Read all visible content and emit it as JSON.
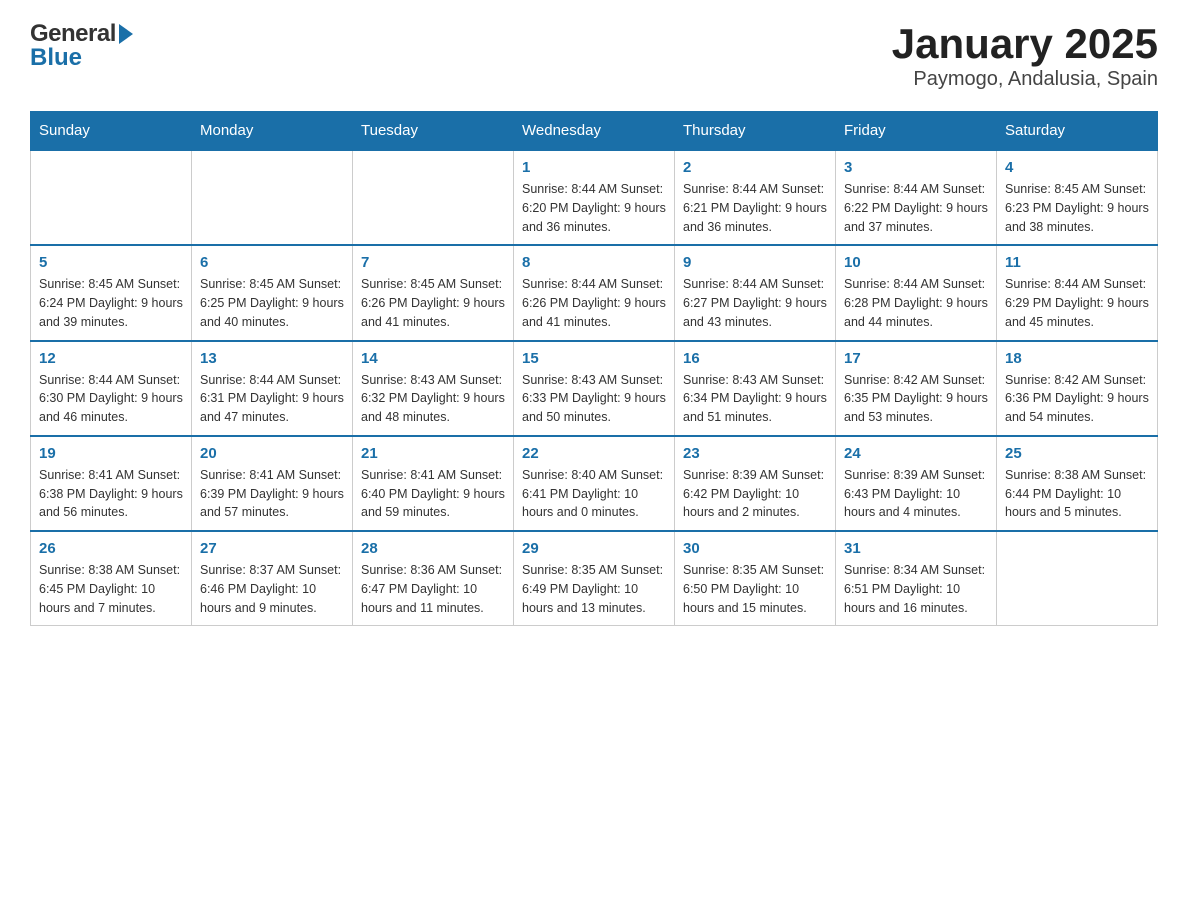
{
  "header": {
    "logo_general": "General",
    "logo_blue": "Blue",
    "title": "January 2025",
    "subtitle": "Paymogo, Andalusia, Spain"
  },
  "calendar": {
    "days_of_week": [
      "Sunday",
      "Monday",
      "Tuesday",
      "Wednesday",
      "Thursday",
      "Friday",
      "Saturday"
    ],
    "weeks": [
      {
        "days": [
          {
            "num": "",
            "info": ""
          },
          {
            "num": "",
            "info": ""
          },
          {
            "num": "",
            "info": ""
          },
          {
            "num": "1",
            "info": "Sunrise: 8:44 AM\nSunset: 6:20 PM\nDaylight: 9 hours and 36 minutes."
          },
          {
            "num": "2",
            "info": "Sunrise: 8:44 AM\nSunset: 6:21 PM\nDaylight: 9 hours and 36 minutes."
          },
          {
            "num": "3",
            "info": "Sunrise: 8:44 AM\nSunset: 6:22 PM\nDaylight: 9 hours and 37 minutes."
          },
          {
            "num": "4",
            "info": "Sunrise: 8:45 AM\nSunset: 6:23 PM\nDaylight: 9 hours and 38 minutes."
          }
        ]
      },
      {
        "days": [
          {
            "num": "5",
            "info": "Sunrise: 8:45 AM\nSunset: 6:24 PM\nDaylight: 9 hours and 39 minutes."
          },
          {
            "num": "6",
            "info": "Sunrise: 8:45 AM\nSunset: 6:25 PM\nDaylight: 9 hours and 40 minutes."
          },
          {
            "num": "7",
            "info": "Sunrise: 8:45 AM\nSunset: 6:26 PM\nDaylight: 9 hours and 41 minutes."
          },
          {
            "num": "8",
            "info": "Sunrise: 8:44 AM\nSunset: 6:26 PM\nDaylight: 9 hours and 41 minutes."
          },
          {
            "num": "9",
            "info": "Sunrise: 8:44 AM\nSunset: 6:27 PM\nDaylight: 9 hours and 43 minutes."
          },
          {
            "num": "10",
            "info": "Sunrise: 8:44 AM\nSunset: 6:28 PM\nDaylight: 9 hours and 44 minutes."
          },
          {
            "num": "11",
            "info": "Sunrise: 8:44 AM\nSunset: 6:29 PM\nDaylight: 9 hours and 45 minutes."
          }
        ]
      },
      {
        "days": [
          {
            "num": "12",
            "info": "Sunrise: 8:44 AM\nSunset: 6:30 PM\nDaylight: 9 hours and 46 minutes."
          },
          {
            "num": "13",
            "info": "Sunrise: 8:44 AM\nSunset: 6:31 PM\nDaylight: 9 hours and 47 minutes."
          },
          {
            "num": "14",
            "info": "Sunrise: 8:43 AM\nSunset: 6:32 PM\nDaylight: 9 hours and 48 minutes."
          },
          {
            "num": "15",
            "info": "Sunrise: 8:43 AM\nSunset: 6:33 PM\nDaylight: 9 hours and 50 minutes."
          },
          {
            "num": "16",
            "info": "Sunrise: 8:43 AM\nSunset: 6:34 PM\nDaylight: 9 hours and 51 minutes."
          },
          {
            "num": "17",
            "info": "Sunrise: 8:42 AM\nSunset: 6:35 PM\nDaylight: 9 hours and 53 minutes."
          },
          {
            "num": "18",
            "info": "Sunrise: 8:42 AM\nSunset: 6:36 PM\nDaylight: 9 hours and 54 minutes."
          }
        ]
      },
      {
        "days": [
          {
            "num": "19",
            "info": "Sunrise: 8:41 AM\nSunset: 6:38 PM\nDaylight: 9 hours and 56 minutes."
          },
          {
            "num": "20",
            "info": "Sunrise: 8:41 AM\nSunset: 6:39 PM\nDaylight: 9 hours and 57 minutes."
          },
          {
            "num": "21",
            "info": "Sunrise: 8:41 AM\nSunset: 6:40 PM\nDaylight: 9 hours and 59 minutes."
          },
          {
            "num": "22",
            "info": "Sunrise: 8:40 AM\nSunset: 6:41 PM\nDaylight: 10 hours and 0 minutes."
          },
          {
            "num": "23",
            "info": "Sunrise: 8:39 AM\nSunset: 6:42 PM\nDaylight: 10 hours and 2 minutes."
          },
          {
            "num": "24",
            "info": "Sunrise: 8:39 AM\nSunset: 6:43 PM\nDaylight: 10 hours and 4 minutes."
          },
          {
            "num": "25",
            "info": "Sunrise: 8:38 AM\nSunset: 6:44 PM\nDaylight: 10 hours and 5 minutes."
          }
        ]
      },
      {
        "days": [
          {
            "num": "26",
            "info": "Sunrise: 8:38 AM\nSunset: 6:45 PM\nDaylight: 10 hours and 7 minutes."
          },
          {
            "num": "27",
            "info": "Sunrise: 8:37 AM\nSunset: 6:46 PM\nDaylight: 10 hours and 9 minutes."
          },
          {
            "num": "28",
            "info": "Sunrise: 8:36 AM\nSunset: 6:47 PM\nDaylight: 10 hours and 11 minutes."
          },
          {
            "num": "29",
            "info": "Sunrise: 8:35 AM\nSunset: 6:49 PM\nDaylight: 10 hours and 13 minutes."
          },
          {
            "num": "30",
            "info": "Sunrise: 8:35 AM\nSunset: 6:50 PM\nDaylight: 10 hours and 15 minutes."
          },
          {
            "num": "31",
            "info": "Sunrise: 8:34 AM\nSunset: 6:51 PM\nDaylight: 10 hours and 16 minutes."
          },
          {
            "num": "",
            "info": ""
          }
        ]
      }
    ]
  }
}
